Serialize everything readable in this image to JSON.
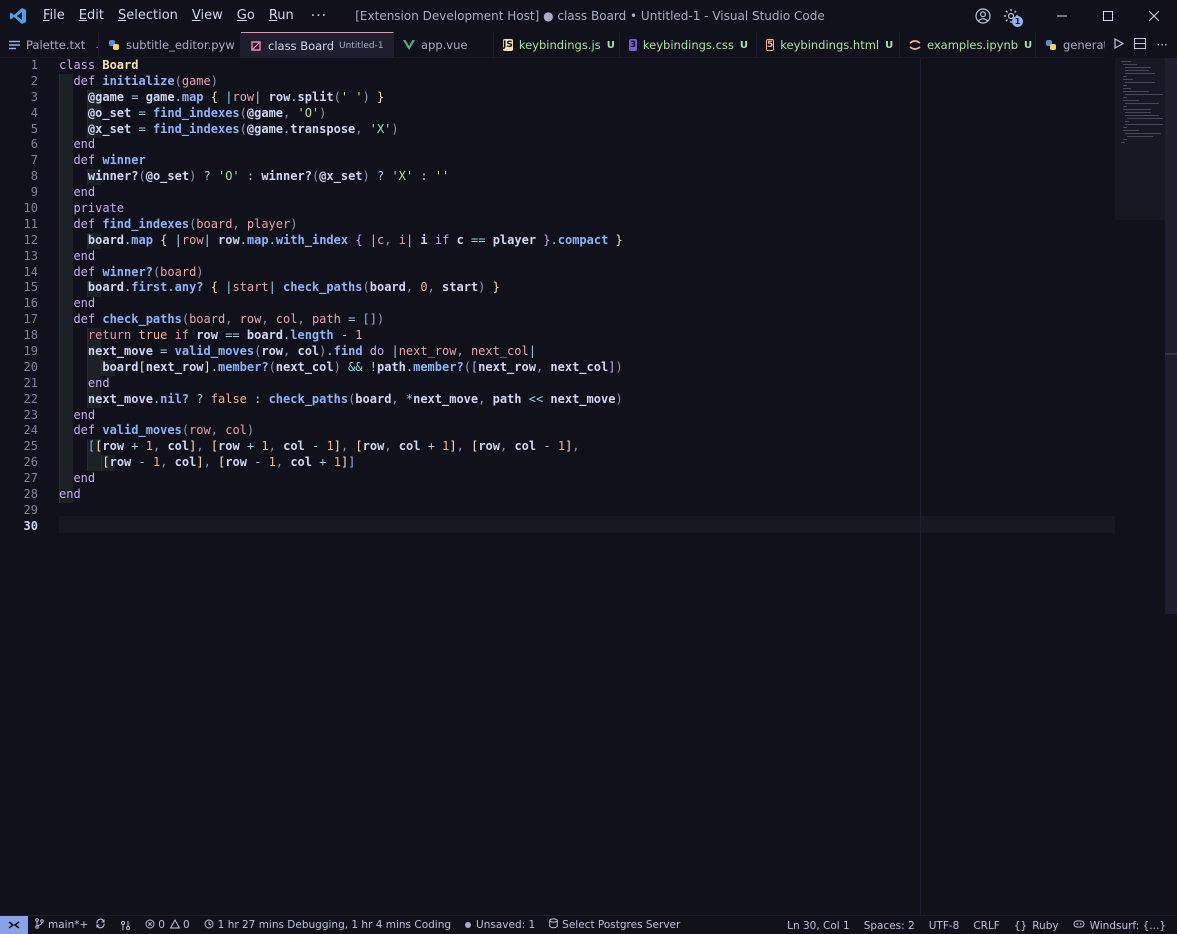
{
  "titlebar": {
    "menus": [
      {
        "first": "F",
        "rest": "ile"
      },
      {
        "first": "E",
        "rest": "dit"
      },
      {
        "first": "S",
        "rest": "election"
      },
      {
        "first": "V",
        "rest": "iew"
      },
      {
        "first": "G",
        "rest": "o"
      },
      {
        "first": "R",
        "rest": "un"
      }
    ],
    "more": "···",
    "title": "[Extension Development Host] ● class Board • Untitled-1 - Visual Studio Code",
    "notification_count": "1"
  },
  "tabs": [
    {
      "label": "Palette.txt",
      "icon": "text-file-icon",
      "pinned": true
    },
    {
      "label": "subtitle_editor.pyw",
      "icon": "python-icon"
    },
    {
      "label": "class Board",
      "desc": "Untitled-1",
      "icon": "ruby-icon",
      "active": true,
      "dirty": true
    },
    {
      "label": "app.vue",
      "icon": "vue-icon"
    },
    {
      "label": "keybindings.js",
      "icon": "js-icon",
      "status": "U"
    },
    {
      "label": "keybindings.css",
      "icon": "css-icon",
      "status": "U"
    },
    {
      "label": "keybindings.html",
      "icon": "html-icon",
      "status": "U"
    },
    {
      "label": "examples.ipynb",
      "icon": "jupyter-icon",
      "status": "U"
    },
    {
      "label": "generat",
      "icon": "python-icon"
    }
  ],
  "editor": {
    "line_numbers": [
      "1",
      "2",
      "3",
      "4",
      "5",
      "6",
      "7",
      "8",
      "9",
      "10",
      "11",
      "12",
      "13",
      "14",
      "15",
      "16",
      "17",
      "18",
      "19",
      "20",
      "21",
      "22",
      "23",
      "24",
      "25",
      "26",
      "27",
      "28",
      "29",
      "30"
    ],
    "current_line": "30",
    "language": "ruby"
  },
  "colors": {
    "background": "#11111b",
    "keyword": "#f38ba8",
    "string": "#a6e3a1",
    "number": "#fab387",
    "function": "#89b4fa",
    "accent": "#8aa2e8"
  },
  "statusbar": {
    "remote_icon": "remote-icon",
    "branch": "main*+",
    "errors": "0",
    "warnings": "0",
    "time_tracking": "1 hr 27 mins Debugging, 1 hr 4 mins Coding",
    "unsaved": "Unsaved: 1",
    "postgres": "Select Postgres Server",
    "position": "Ln 30, Col 1",
    "spaces": "Spaces: 2",
    "encoding": "UTF-8",
    "eol": "CRLF",
    "language": "Ruby",
    "windsurf": "Windsurf: {...}"
  }
}
